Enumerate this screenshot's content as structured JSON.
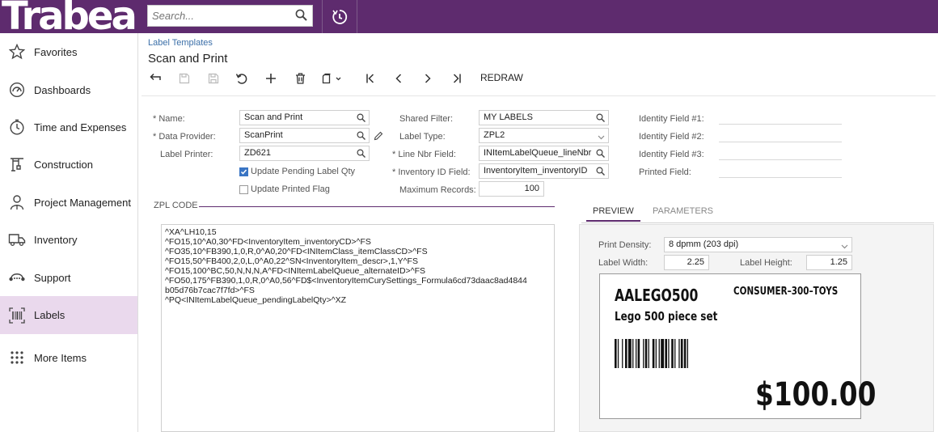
{
  "topbar": {
    "logo_text": "Trabea",
    "search_placeholder": "Search..."
  },
  "sidebar": {
    "items": [
      {
        "label": "Favorites",
        "icon": "star-icon"
      },
      {
        "label": "Dashboards",
        "icon": "dashboard-icon"
      },
      {
        "label": "Time and Expenses",
        "icon": "clock-icon"
      },
      {
        "label": "Construction",
        "icon": "construction-icon"
      },
      {
        "label": "Project Management",
        "icon": "person-icon"
      },
      {
        "label": "Inventory",
        "icon": "truck-icon"
      },
      {
        "label": "Support",
        "icon": "support-icon"
      },
      {
        "label": "Labels",
        "icon": "barcode-icon"
      },
      {
        "label": "More Items",
        "icon": "grid-icon"
      }
    ],
    "active": "Labels"
  },
  "header": {
    "breadcrumb": "Label Templates",
    "title": "Scan and Print"
  },
  "toolbar": {
    "redraw_label": "REDRAW"
  },
  "form": {
    "name_label": "Name:",
    "name_value": "Scan and Print",
    "data_provider_label": "Data Provider:",
    "data_provider_value": "ScanPrint",
    "label_printer_label": "Label Printer:",
    "label_printer_value": "ZD621",
    "update_pending_label": "Update Pending Label Qty",
    "update_pending_checked": true,
    "update_printed_label": "Update Printed Flag",
    "update_printed_checked": false,
    "shared_filter_label": "Shared Filter:",
    "shared_filter_value": "MY LABELS",
    "label_type_label": "Label Type:",
    "label_type_value": "ZPL2",
    "line_nbr_label": "Line Nbr Field:",
    "line_nbr_value": "INItemLabelQueue_lineNbr",
    "inventory_id_label": "Inventory ID Field:",
    "inventory_id_value": "InventoryItem_inventoryID",
    "max_records_label": "Maximum Records:",
    "max_records_value": "100",
    "identity1_label": "Identity Field #1:",
    "identity2_label": "Identity Field #2:",
    "identity3_label": "Identity Field #3:",
    "printed_field_label": "Printed Field:"
  },
  "zpl": {
    "header": "ZPL CODE",
    "lines": [
      "^XA^LH10,15",
      "^FO15,10^A0,30^FD<InventoryItem_inventoryCD>^FS",
      "^FO35,10^FB390,1,0,R,0^A0,20^FD<INItemClass_itemClassCD>^FS",
      "^FO15,50^FB400,2,0,L,0^A0,22^SN<InventoryItem_descr>,1,Y^FS",
      "^FO15,100^BC,50,N,N,N,A^FD<INItemLabelQueue_alternateID>^FS",
      "^FO50,175^FB390,1,0,R,0^A0,56^FD$<InventoryItemCurySettings_Formula6cd73daac8ad4844",
      "b05d76b7cac7f7fd>^FS",
      "^PQ<INItemLabelQueue_pendingLabelQty>^XZ"
    ]
  },
  "preview": {
    "tab_preview": "PREVIEW",
    "tab_parameters": "PARAMETERS",
    "print_density_label": "Print Density:",
    "print_density_value": "8 dpmm (203 dpi)",
    "label_width_label": "Label Width:",
    "label_width_value": "2.25",
    "label_height_label": "Label Height:",
    "label_height_value": "1.25",
    "card": {
      "item_code": "AALEGO500",
      "item_class": "CONSUMER–300–TOYS",
      "description": "Lego 500 piece set",
      "price": "$100.00"
    }
  },
  "colors": {
    "brand": "#5e2b6e",
    "active_nav": "#ead9ed",
    "link": "#3b6fa8"
  }
}
